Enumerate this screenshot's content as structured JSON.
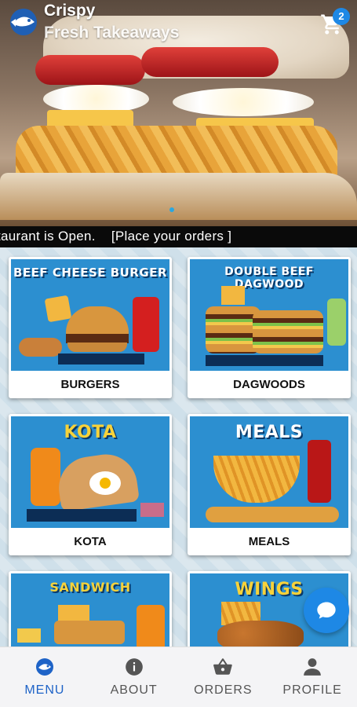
{
  "header": {
    "title_line1": "Crispy",
    "title_line2": "Fresh Takeaways",
    "cart_count": "2"
  },
  "ticker": {
    "text": "taurant is Open.    [Place your orders ]"
  },
  "categories": [
    {
      "label": "BURGERS",
      "art_title": "BEEF CHEESE BURGER"
    },
    {
      "label": "DAGWOODS",
      "art_title": "DOUBLE BEEF DAGWOOD"
    },
    {
      "label": "KOTA",
      "art_title": "KOTA"
    },
    {
      "label": "MEALS",
      "art_title": "MEALS"
    },
    {
      "label": "",
      "art_title": "SANDWICH"
    },
    {
      "label": "",
      "art_title": "WINGS"
    }
  ],
  "nav": {
    "items": [
      {
        "label": "MENU",
        "icon": "menu-logo-icon",
        "active": true
      },
      {
        "label": "ABOUT",
        "icon": "info-icon",
        "active": false
      },
      {
        "label": "ORDERS",
        "icon": "basket-icon",
        "active": false
      },
      {
        "label": "PROFILE",
        "icon": "person-icon",
        "active": false
      }
    ]
  },
  "colors": {
    "accent": "#1e88e5",
    "active_nav": "#1e63c7",
    "ticker_bg": "#0a0a0a"
  }
}
